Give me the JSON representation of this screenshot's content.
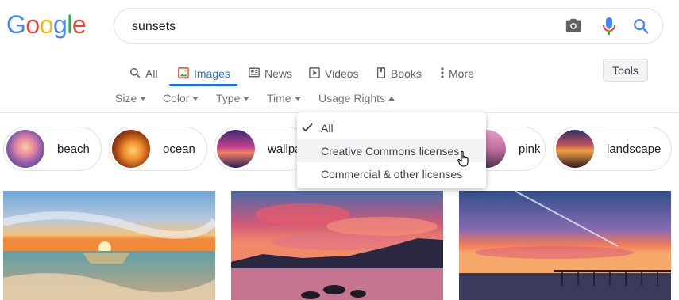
{
  "logo": {
    "letters": [
      "G",
      "o",
      "o",
      "g",
      "l",
      "e"
    ]
  },
  "search": {
    "query": "sunsets"
  },
  "tabs": [
    {
      "label": "All",
      "icon": "search-icon"
    },
    {
      "label": "Images",
      "icon": "image-icon"
    },
    {
      "label": "News",
      "icon": "newspaper-icon"
    },
    {
      "label": "Videos",
      "icon": "play-icon"
    },
    {
      "label": "Books",
      "icon": "book-icon"
    },
    {
      "label": "More",
      "icon": "kebab-icon"
    }
  ],
  "tools_label": "Tools",
  "filters": [
    "Size",
    "Color",
    "Type",
    "Time",
    "Usage Rights"
  ],
  "chips": [
    {
      "label": "beach"
    },
    {
      "label": "ocean"
    },
    {
      "label": "wallpa"
    },
    {
      "label": "pink"
    },
    {
      "label": "landscape"
    }
  ],
  "usage_menu": {
    "items": [
      {
        "label": "All",
        "checked": true
      },
      {
        "label": "Creative Commons licenses",
        "hovered": true
      },
      {
        "label": "Commercial & other licenses"
      }
    ]
  },
  "colors": {
    "accent": "#1a73e8",
    "logo_blue": "#4285f4",
    "logo_red": "#ea4335",
    "logo_yellow": "#fbbc05",
    "logo_green": "#34a853"
  }
}
